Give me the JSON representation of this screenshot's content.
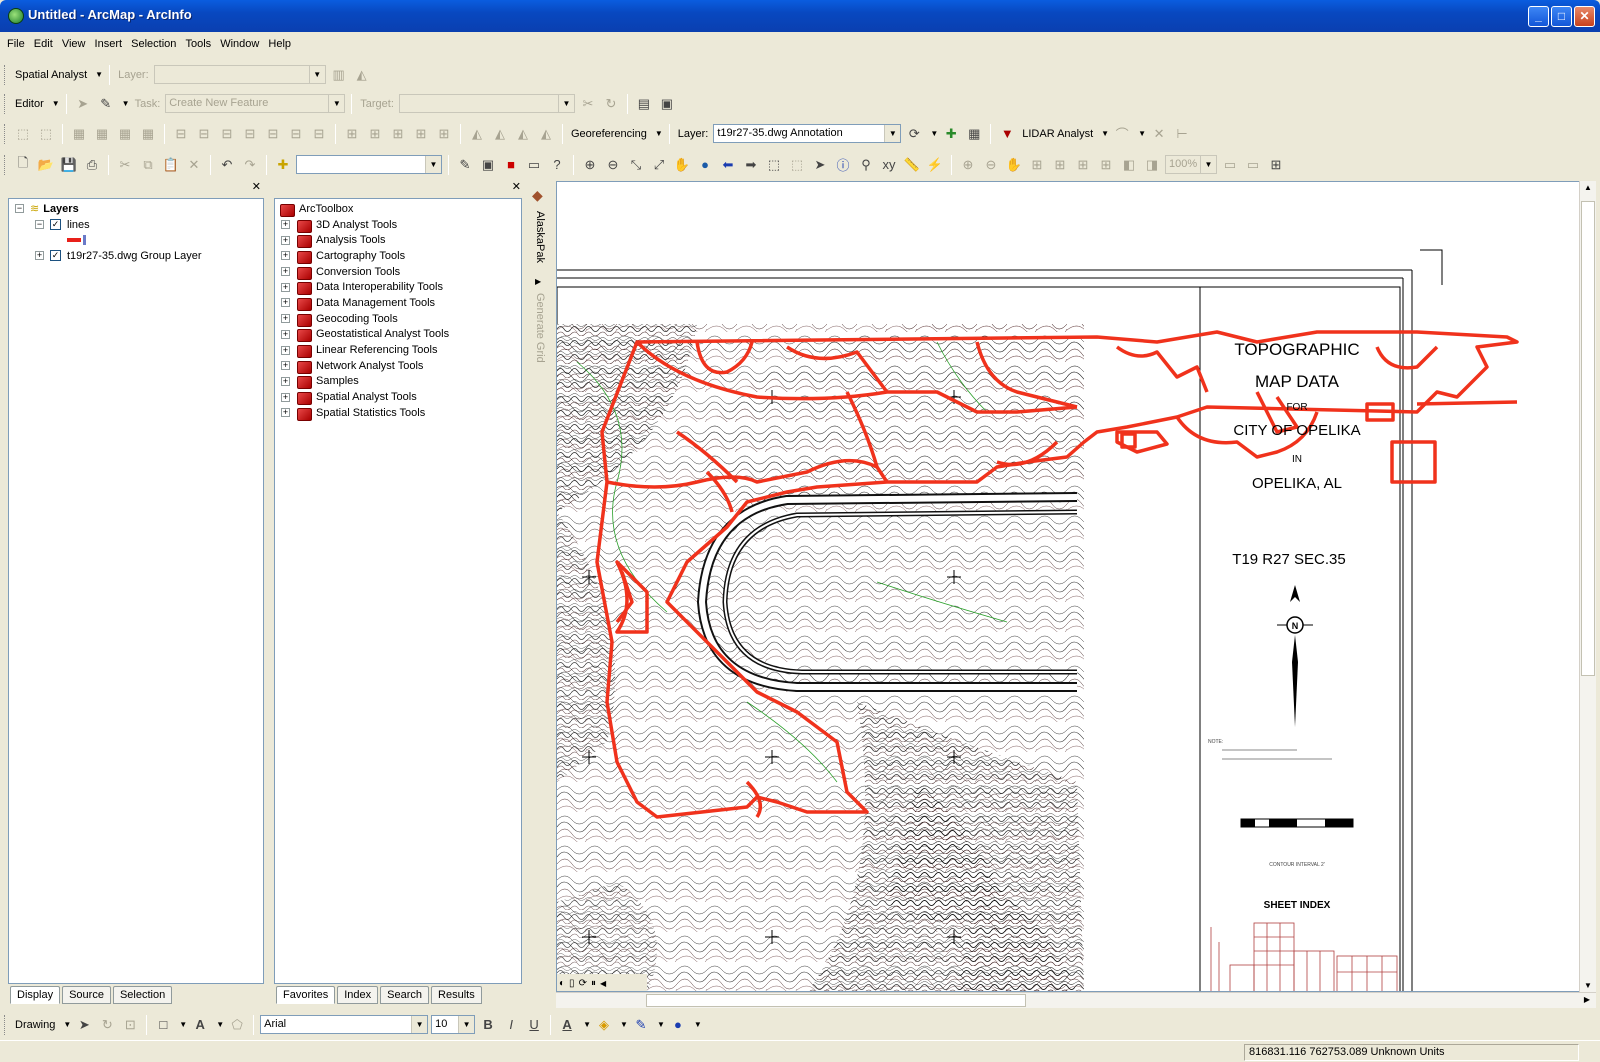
{
  "window": {
    "title": "Untitled - ArcMap - ArcInfo"
  },
  "menu": [
    "File",
    "Edit",
    "View",
    "Insert",
    "Selection",
    "Tools",
    "Window",
    "Help"
  ],
  "spatial_analyst": {
    "label": "Spatial Analyst",
    "layer_label": "Layer:"
  },
  "editor": {
    "label": "Editor",
    "task_label": "Task:",
    "task_value": "Create New Feature",
    "target_label": "Target:"
  },
  "georef": {
    "label": "Georeferencing",
    "layer_label": "Layer:",
    "layer_value": "t19r27-35.dwg Annotation",
    "lidar_label": "LIDAR Analyst"
  },
  "standard": {
    "zoom_value": "100%"
  },
  "toc": {
    "root": "Layers",
    "layers": [
      {
        "name": "lines"
      },
      {
        "name": "t19r27-35.dwg Group Layer"
      }
    ],
    "tabs": [
      "Display",
      "Source",
      "Selection"
    ]
  },
  "toolbox": {
    "root": "ArcToolbox",
    "items": [
      "3D Analyst Tools",
      "Analysis Tools",
      "Cartography Tools",
      "Conversion Tools",
      "Data Interoperability Tools",
      "Data Management Tools",
      "Geocoding Tools",
      "Geostatistical Analyst Tools",
      "Linear Referencing Tools",
      "Network Analyst Tools",
      "Samples",
      "Spatial Analyst Tools",
      "Spatial Statistics Tools"
    ],
    "tabs": [
      "Favorites",
      "Index",
      "Search",
      "Results"
    ]
  },
  "side_tabs": {
    "alaskapak": "AlaskaPak",
    "generate_grid": "Generate Grid"
  },
  "map": {
    "title_line1": "TOPOGRAPHIC",
    "title_line2": "MAP DATA",
    "for": "FOR",
    "city": "CITY OF OPELIKA",
    "in": "IN",
    "place": "OPELIKA, AL",
    "sheet": "T19 R27 SEC.35",
    "north": "N",
    "note": "NOTE:",
    "contour": "CONTOUR INTERVAL 2'",
    "sheet_index": "SHEET INDEX"
  },
  "drawing": {
    "label": "Drawing",
    "font": "Arial",
    "size": "10"
  },
  "status": {
    "coords": "816831.116  762753.089 Unknown Units"
  }
}
